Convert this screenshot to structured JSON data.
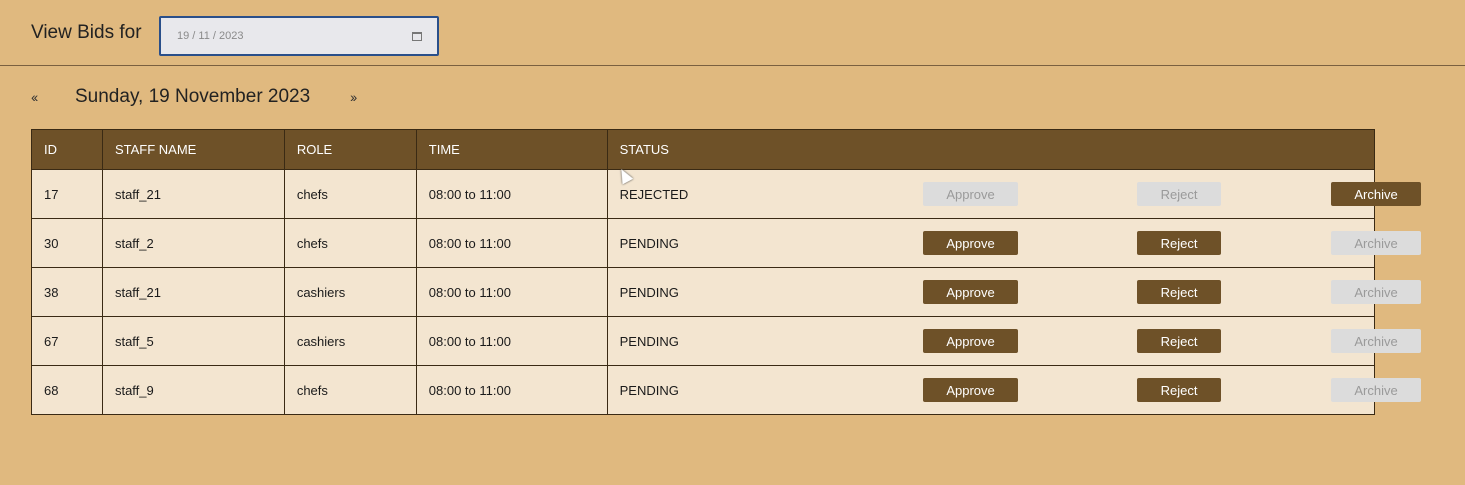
{
  "header": {
    "label": "View Bids for",
    "date_value": "19 / 11 / 2023"
  },
  "nav": {
    "prev_symbol": "‹‹",
    "next_symbol": "››",
    "day_title": "Sunday, 19 November 2023"
  },
  "table": {
    "columns": [
      "ID",
      "STAFF NAME",
      "ROLE",
      "TIME",
      "STATUS"
    ],
    "rows": [
      {
        "id": "17",
        "staff": "staff_21",
        "role": "chefs",
        "time": "08:00 to 11:00",
        "status": "REJECTED",
        "approve": "Approve",
        "reject": "Reject",
        "archive": "Archive",
        "approve_enabled": false,
        "reject_enabled": false,
        "archive_enabled": true
      },
      {
        "id": "30",
        "staff": "staff_2",
        "role": "chefs",
        "time": "08:00 to 11:00",
        "status": "PENDING",
        "approve": "Approve",
        "reject": "Reject",
        "archive": "Archive",
        "approve_enabled": true,
        "reject_enabled": true,
        "archive_enabled": false
      },
      {
        "id": "38",
        "staff": "staff_21",
        "role": "cashiers",
        "time": "08:00 to 11:00",
        "status": "PENDING",
        "approve": "Approve",
        "reject": "Reject",
        "archive": "Archive",
        "approve_enabled": true,
        "reject_enabled": true,
        "archive_enabled": false
      },
      {
        "id": "67",
        "staff": "staff_5",
        "role": "cashiers",
        "time": "08:00 to 11:00",
        "status": "PENDING",
        "approve": "Approve",
        "reject": "Reject",
        "archive": "Archive",
        "approve_enabled": true,
        "reject_enabled": true,
        "archive_enabled": false
      },
      {
        "id": "68",
        "staff": "staff_9",
        "role": "chefs",
        "time": "08:00 to 11:00",
        "status": "PENDING",
        "approve": "Approve",
        "reject": "Reject",
        "archive": "Archive",
        "approve_enabled": true,
        "reject_enabled": true,
        "archive_enabled": false
      }
    ]
  },
  "colors": {
    "background": "#e0b97f",
    "accent": "#6e5128",
    "row_bg": "#f3e5d0",
    "disabled_bg": "#dcdcdc"
  },
  "icons": {
    "date_picker": "calendar-icon"
  }
}
